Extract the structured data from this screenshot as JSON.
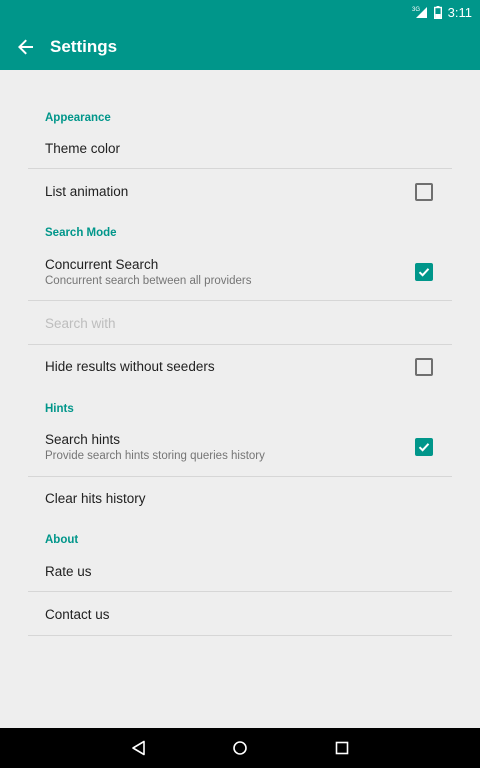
{
  "status_bar": {
    "network": "3G",
    "time": "3:11"
  },
  "app_bar": {
    "title": "Settings",
    "back_icon": "arrow-back-icon"
  },
  "sections": [
    {
      "header": "Appearance"
    },
    {
      "header": "Search Mode"
    },
    {
      "header": "Hints"
    },
    {
      "header": "About"
    }
  ],
  "items": {
    "theme_color": {
      "label": "Theme color"
    },
    "list_animation": {
      "label": "List animation",
      "checked": false
    },
    "concurrent_search": {
      "label": "Concurrent Search",
      "summary": "Concurrent search between all providers",
      "checked": true
    },
    "search_with": {
      "label": "Search with",
      "enabled": false
    },
    "hide_results": {
      "label": "Hide results without seeders",
      "checked": false
    },
    "search_hints": {
      "label": "Search hints",
      "summary": "Provide search hints storing queries history",
      "checked": true
    },
    "clear_history": {
      "label": "Clear hits history"
    },
    "rate_us": {
      "label": "Rate us"
    },
    "contact_us": {
      "label": "Contact us"
    }
  },
  "colors": {
    "accent": "#00968a",
    "background": "#eeeeee",
    "navbar": "#000000"
  },
  "nav_bar": {
    "back": "back-triangle-icon",
    "home": "home-circle-icon",
    "recents": "recents-square-icon"
  }
}
